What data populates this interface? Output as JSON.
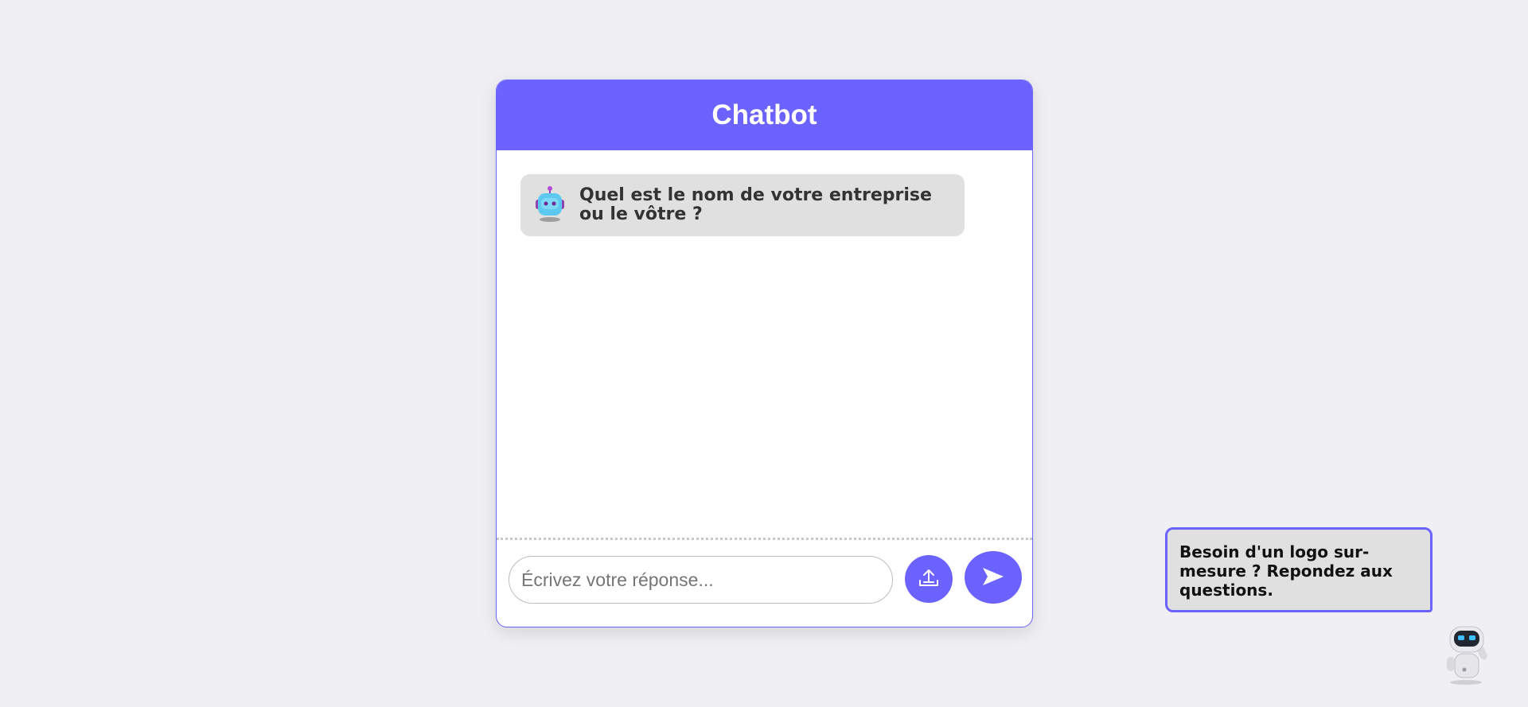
{
  "chat": {
    "title": "Chatbot",
    "messages": [
      {
        "sender": "bot",
        "icon": "robot-face-icon",
        "text": "Quel est le nom de votre entreprise ou le vôtre ?"
      }
    ],
    "input": {
      "placeholder": "Écrivez votre réponse...",
      "value": ""
    },
    "upload_icon": "upload-icon",
    "send_icon": "send-arrow-icon"
  },
  "promo": {
    "text": "Besoin d'un logo sur-mesure ? Repondez aux questions.",
    "mascot_icon": "robot-mascot-icon"
  },
  "colors": {
    "accent": "#6c63ff",
    "page_background": "#f0f0f4",
    "bubble_background": "#e0e0e0"
  }
}
